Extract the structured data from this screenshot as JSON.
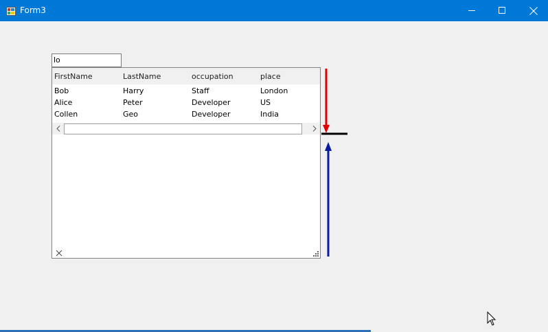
{
  "window": {
    "title": "Form3"
  },
  "search": {
    "value": "lo"
  },
  "grid": {
    "columns": [
      "FirstName",
      "LastName",
      "occupation",
      "place"
    ],
    "rows": [
      [
        "Bob",
        "Harry",
        "Staff",
        "London"
      ],
      [
        "Alice",
        "Peter",
        "Developer",
        "US"
      ],
      [
        "Collen",
        "Geo",
        "Developer",
        "India"
      ]
    ]
  },
  "colors": {
    "titlebar": "#0078d7",
    "red_arrow": "#e00000",
    "blue_arrow": "#0a1aa0"
  },
  "icons": [
    "app-icon",
    "minimize-icon",
    "maximize-icon",
    "close-icon",
    "scroll-left-icon",
    "scroll-right-icon",
    "close-x-icon",
    "resize-grip-icon",
    "mouse-cursor-icon"
  ]
}
